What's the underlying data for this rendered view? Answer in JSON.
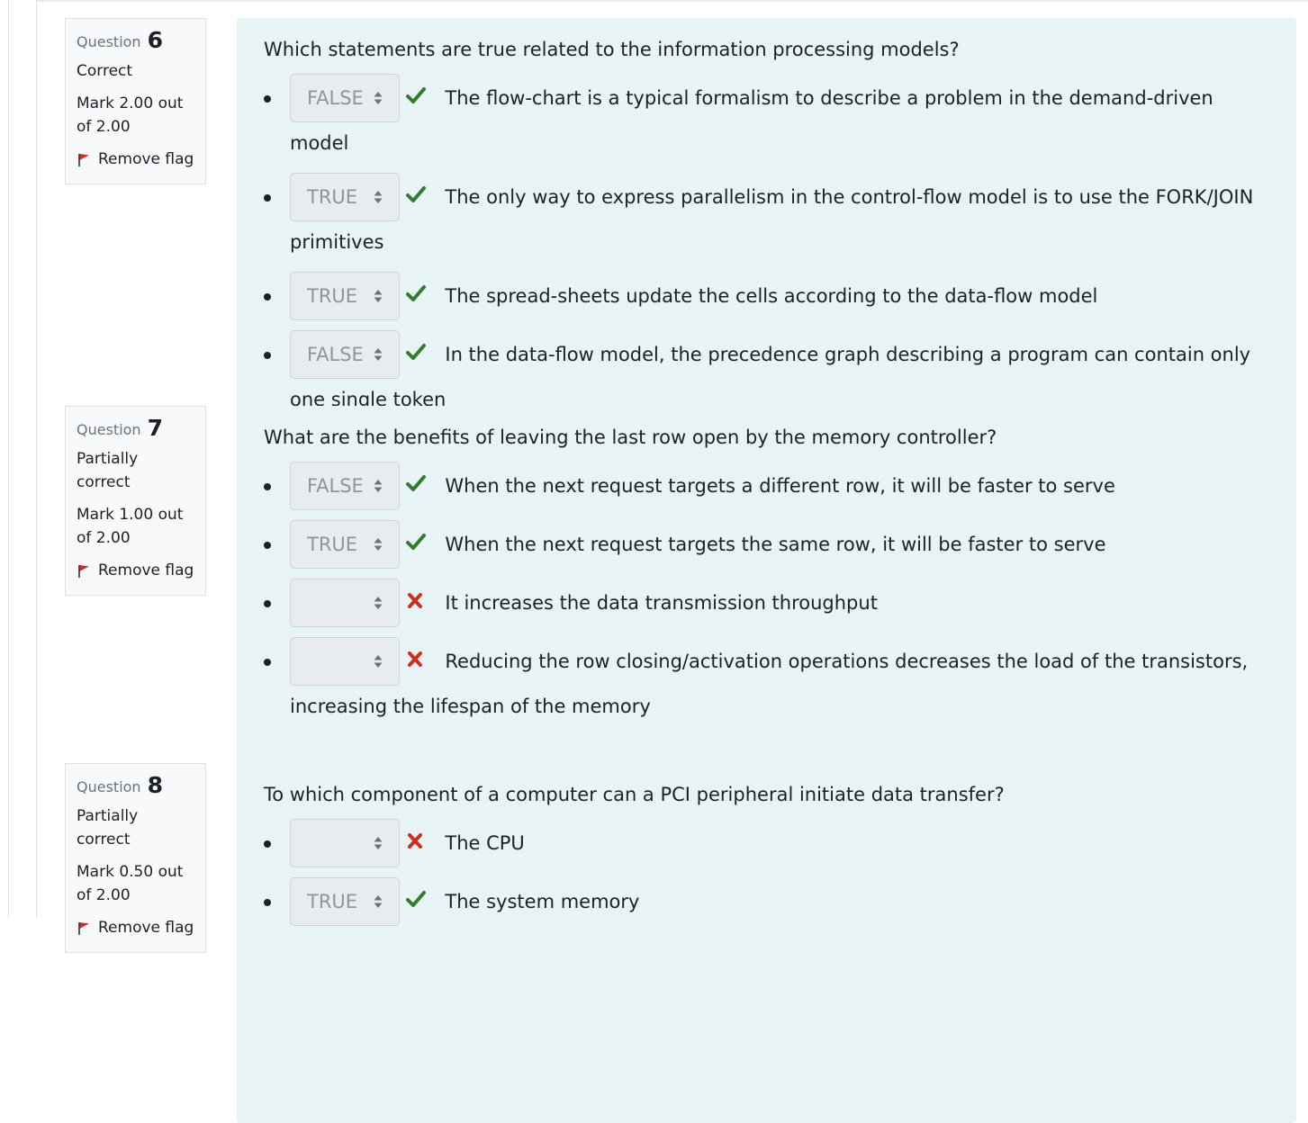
{
  "questions": [
    {
      "number_prefix": "Question",
      "number": "6",
      "state": "Correct",
      "grade": "Mark 2.00 out of 2.00",
      "flag": "Remove flag",
      "text": "Which statements are true related to the information processing models?",
      "answers": [
        {
          "value": "FALSE",
          "mark": "check-icon",
          "text": "The flow-chart is a typical formalism to describe a problem in the demand-driven model"
        },
        {
          "value": "TRUE",
          "mark": "check-icon",
          "text": "The only way to express parallelism in the control-flow model is to use the FORK/JOIN primitives"
        },
        {
          "value": "TRUE",
          "mark": "check-icon",
          "text": "The spread-sheets update the cells according to the data-flow model"
        },
        {
          "value": "FALSE",
          "mark": "check-icon",
          "text": "In the data-flow model, the precedence graph describing a program can contain only one single token"
        }
      ]
    },
    {
      "number_prefix": "Question",
      "number": "7",
      "state": "Partially correct",
      "grade": "Mark 1.00 out of 2.00",
      "flag": "Remove flag",
      "text": "What are the benefits of leaving the last row open by the memory controller?",
      "answers": [
        {
          "value": "FALSE",
          "mark": "check-icon",
          "text": "When the next request targets a different row, it will be faster to serve"
        },
        {
          "value": "TRUE",
          "mark": "check-icon",
          "text": "When the next request targets the same row, it will be faster to serve"
        },
        {
          "value": "",
          "mark": "cross-icon",
          "text": "It increases the data transmission throughput"
        },
        {
          "value": "",
          "mark": "cross-icon",
          "text": "Reducing the row closing/activation operations decreases the load of the transistors, increasing the lifespan of the memory"
        }
      ]
    },
    {
      "number_prefix": "Question",
      "number": "8",
      "state": "Partially correct",
      "grade": "Mark 0.50 out of 2.00",
      "flag": "Remove flag",
      "text": "To which component of a computer can a PCI peripheral initiate data transfer?",
      "answers": [
        {
          "value": "",
          "mark": "cross-icon",
          "text": "The CPU"
        },
        {
          "value": "TRUE",
          "mark": "check-icon",
          "text": "The system memory"
        }
      ]
    }
  ],
  "colors": {
    "correct": "#357a32",
    "incorrect": "#ca3120",
    "flag": "#ca3120",
    "content_bg": "#e7f3f5"
  }
}
